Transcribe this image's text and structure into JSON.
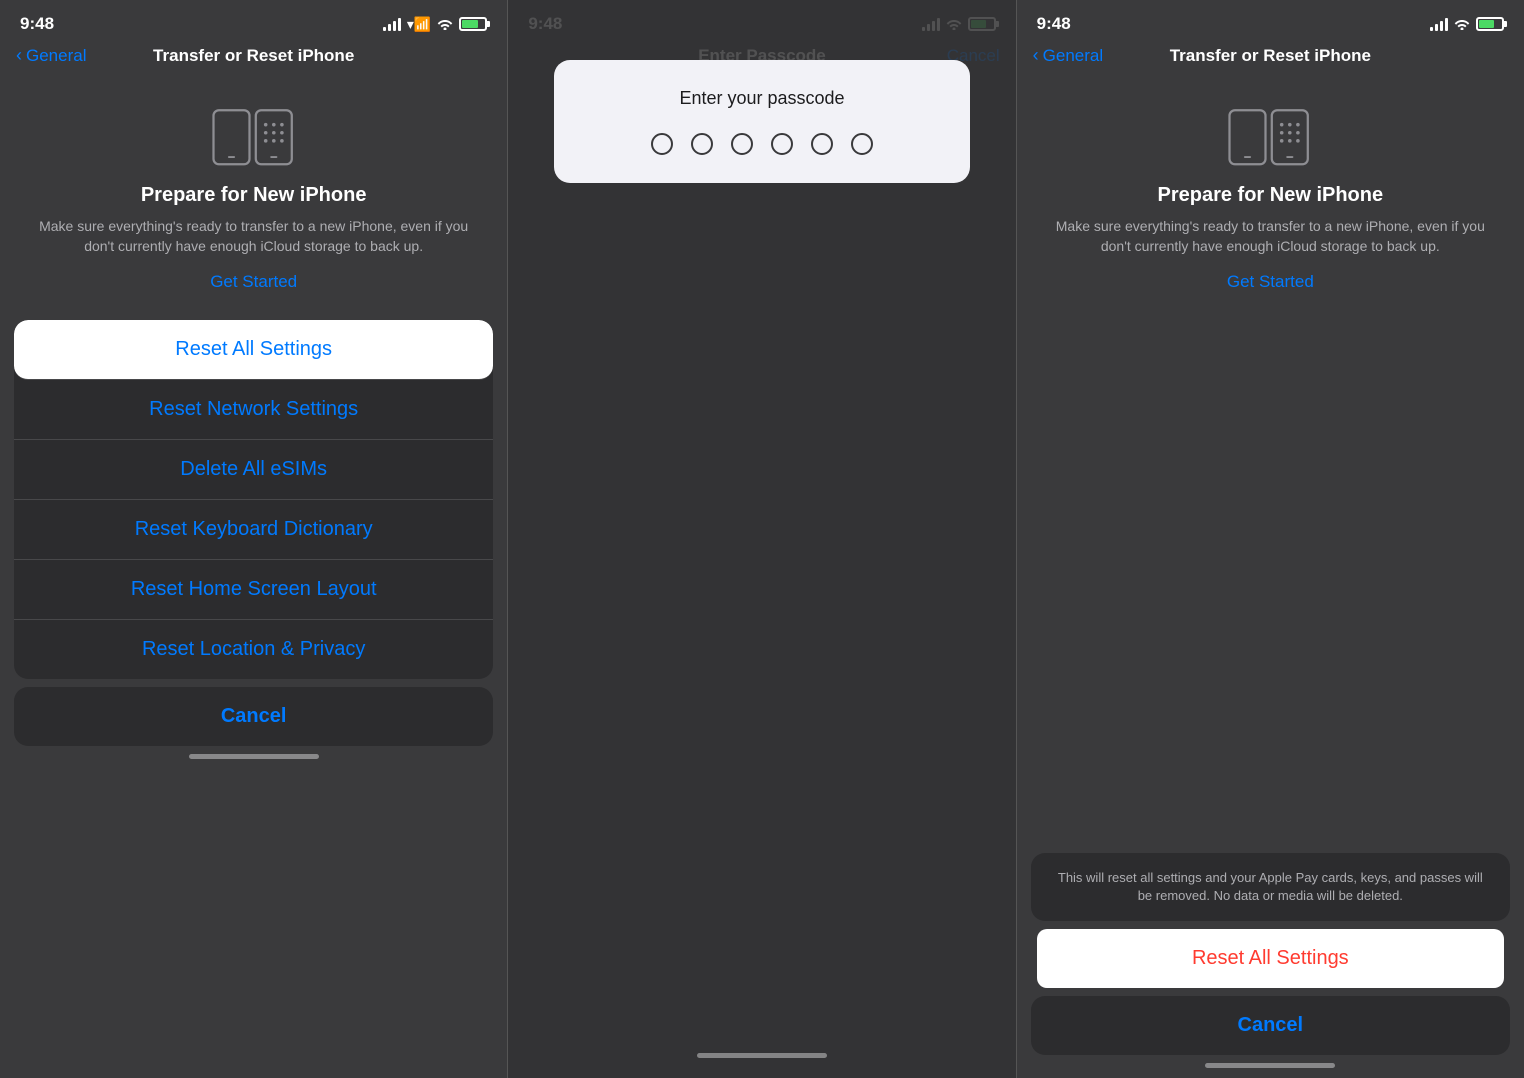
{
  "screens": [
    {
      "id": "screen1",
      "statusBar": {
        "time": "9:48",
        "signal": true,
        "wifi": true,
        "battery": true
      },
      "navBar": {
        "backLabel": "General",
        "title": "Transfer or Reset iPhone"
      },
      "prepare": {
        "title": "Prepare for New iPhone",
        "description": "Make sure everything's ready to transfer to a new iPhone, even if you don't currently have enough iCloud storage to back up.",
        "getStartedLabel": "Get Started"
      },
      "resetOptions": [
        {
          "label": "Reset All Settings",
          "highlighted": true
        },
        {
          "label": "Reset Network Settings",
          "highlighted": false
        },
        {
          "label": "Delete All eSIMs",
          "highlighted": false
        },
        {
          "label": "Reset Keyboard Dictionary",
          "highlighted": false
        },
        {
          "label": "Reset Home Screen Layout",
          "highlighted": false
        },
        {
          "label": "Reset Location & Privacy",
          "highlighted": false
        }
      ],
      "cancelLabel": "Cancel"
    },
    {
      "id": "screen2",
      "statusBar": {
        "time": "9:48",
        "signal": true,
        "wifi": true,
        "battery": true
      },
      "navBar": {
        "backLabel": "",
        "title": "Enter Passcode",
        "cancelLabel": "Cancel"
      },
      "passcodeDialog": {
        "title": "Enter your passcode",
        "dotsCount": 6
      }
    },
    {
      "id": "screen3",
      "statusBar": {
        "time": "9:48",
        "signal": true,
        "wifi": true,
        "battery": true
      },
      "navBar": {
        "backLabel": "General",
        "title": "Transfer or Reset iPhone"
      },
      "prepare": {
        "title": "Prepare for New iPhone",
        "description": "Make sure everything's ready to transfer to a new iPhone, even if you don't currently have enough iCloud storage to back up.",
        "getStartedLabel": "Get Started"
      },
      "confirmDialog": {
        "description": "This will reset all settings and your Apple Pay cards, keys, and passes will be removed. No data or media will be deleted.",
        "resetLabel": "Reset All Settings",
        "cancelLabel": "Cancel"
      }
    }
  ]
}
